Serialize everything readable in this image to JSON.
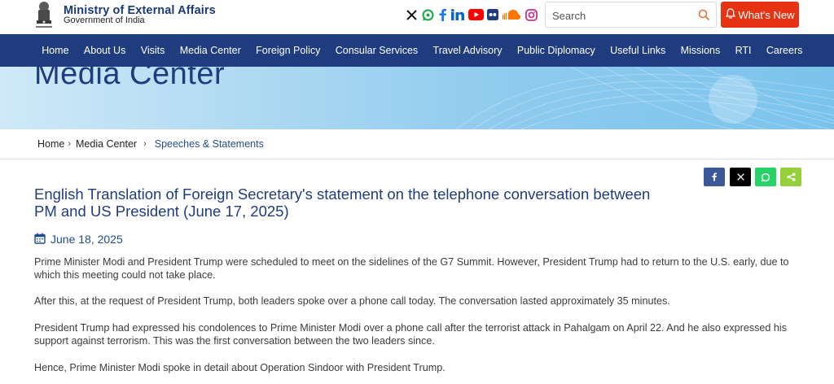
{
  "header": {
    "brand_title": "Ministry of External Affairs",
    "brand_subtitle": "Government of India",
    "search_placeholder": "Search",
    "whats_new_label": "What's New",
    "social_icons": [
      "x-icon",
      "whatsapp-icon",
      "facebook-icon",
      "linkedin-icon",
      "youtube-icon",
      "flickr-icon",
      "soundcloud-icon",
      "instagram-icon"
    ]
  },
  "nav": {
    "items": [
      "Home",
      "About Us",
      "Visits",
      "Media Center",
      "Foreign Policy",
      "Consular Services",
      "Travel Advisory",
      "Public Diplomacy",
      "Useful Links",
      "Missions",
      "RTI",
      "Careers"
    ]
  },
  "banner": {
    "title": "Media Center"
  },
  "breadcrumb": {
    "items": [
      "Home",
      "Media Center"
    ],
    "current": "Speeches & Statements"
  },
  "share": {
    "buttons": [
      {
        "icon": "facebook-icon",
        "color": "#3b5998"
      },
      {
        "icon": "x-icon",
        "color": "#000000"
      },
      {
        "icon": "whatsapp-icon",
        "color": "#25d366"
      },
      {
        "icon": "share-icon",
        "color": "#95d03a"
      }
    ]
  },
  "article": {
    "title": "English Translation of Foreign Secretary's statement on the telephone conversation between PM and US President (June 17, 2025)",
    "date": "June 18, 2025",
    "paragraphs": [
      "Prime Minister Modi and President Trump were scheduled to meet on the sidelines of the G7 Summit. However, President Trump had to return to the U.S. early, due to which this meeting could not take place.",
      "After this, at the request of President Trump, both leaders spoke over a phone call today. The conversation lasted approximately 35 minutes.",
      "President Trump had expressed his condolences to Prime Minister Modi over a phone call after the terrorist attack in Pahalgam on April 22. And he also expressed his support against terrorism. This was the first conversation between the two leaders since.",
      "Hence, Prime Minister Modi spoke in detail about Operation Sindoor with President Trump."
    ]
  },
  "colors": {
    "brand_blue": "#1f3c7e",
    "accent_red": "#e53314",
    "link_blue": "#1f4e8c"
  }
}
